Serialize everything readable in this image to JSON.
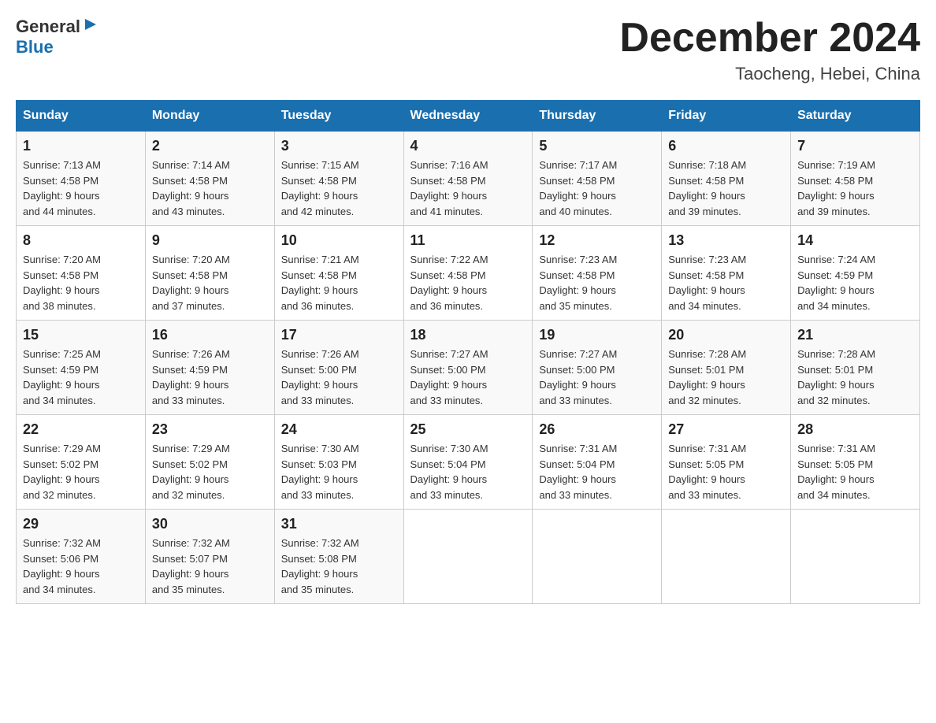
{
  "header": {
    "logo_general": "General",
    "logo_blue": "Blue",
    "month_title": "December 2024",
    "location": "Taocheng, Hebei, China"
  },
  "calendar": {
    "days_of_week": [
      "Sunday",
      "Monday",
      "Tuesday",
      "Wednesday",
      "Thursday",
      "Friday",
      "Saturday"
    ],
    "weeks": [
      [
        {
          "day": "1",
          "sunrise": "7:13 AM",
          "sunset": "4:58 PM",
          "daylight": "9 hours and 44 minutes."
        },
        {
          "day": "2",
          "sunrise": "7:14 AM",
          "sunset": "4:58 PM",
          "daylight": "9 hours and 43 minutes."
        },
        {
          "day": "3",
          "sunrise": "7:15 AM",
          "sunset": "4:58 PM",
          "daylight": "9 hours and 42 minutes."
        },
        {
          "day": "4",
          "sunrise": "7:16 AM",
          "sunset": "4:58 PM",
          "daylight": "9 hours and 41 minutes."
        },
        {
          "day": "5",
          "sunrise": "7:17 AM",
          "sunset": "4:58 PM",
          "daylight": "9 hours and 40 minutes."
        },
        {
          "day": "6",
          "sunrise": "7:18 AM",
          "sunset": "4:58 PM",
          "daylight": "9 hours and 39 minutes."
        },
        {
          "day": "7",
          "sunrise": "7:19 AM",
          "sunset": "4:58 PM",
          "daylight": "9 hours and 39 minutes."
        }
      ],
      [
        {
          "day": "8",
          "sunrise": "7:20 AM",
          "sunset": "4:58 PM",
          "daylight": "9 hours and 38 minutes."
        },
        {
          "day": "9",
          "sunrise": "7:20 AM",
          "sunset": "4:58 PM",
          "daylight": "9 hours and 37 minutes."
        },
        {
          "day": "10",
          "sunrise": "7:21 AM",
          "sunset": "4:58 PM",
          "daylight": "9 hours and 36 minutes."
        },
        {
          "day": "11",
          "sunrise": "7:22 AM",
          "sunset": "4:58 PM",
          "daylight": "9 hours and 36 minutes."
        },
        {
          "day": "12",
          "sunrise": "7:23 AM",
          "sunset": "4:58 PM",
          "daylight": "9 hours and 35 minutes."
        },
        {
          "day": "13",
          "sunrise": "7:23 AM",
          "sunset": "4:58 PM",
          "daylight": "9 hours and 34 minutes."
        },
        {
          "day": "14",
          "sunrise": "7:24 AM",
          "sunset": "4:59 PM",
          "daylight": "9 hours and 34 minutes."
        }
      ],
      [
        {
          "day": "15",
          "sunrise": "7:25 AM",
          "sunset": "4:59 PM",
          "daylight": "9 hours and 34 minutes."
        },
        {
          "day": "16",
          "sunrise": "7:26 AM",
          "sunset": "4:59 PM",
          "daylight": "9 hours and 33 minutes."
        },
        {
          "day": "17",
          "sunrise": "7:26 AM",
          "sunset": "5:00 PM",
          "daylight": "9 hours and 33 minutes."
        },
        {
          "day": "18",
          "sunrise": "7:27 AM",
          "sunset": "5:00 PM",
          "daylight": "9 hours and 33 minutes."
        },
        {
          "day": "19",
          "sunrise": "7:27 AM",
          "sunset": "5:00 PM",
          "daylight": "9 hours and 33 minutes."
        },
        {
          "day": "20",
          "sunrise": "7:28 AM",
          "sunset": "5:01 PM",
          "daylight": "9 hours and 32 minutes."
        },
        {
          "day": "21",
          "sunrise": "7:28 AM",
          "sunset": "5:01 PM",
          "daylight": "9 hours and 32 minutes."
        }
      ],
      [
        {
          "day": "22",
          "sunrise": "7:29 AM",
          "sunset": "5:02 PM",
          "daylight": "9 hours and 32 minutes."
        },
        {
          "day": "23",
          "sunrise": "7:29 AM",
          "sunset": "5:02 PM",
          "daylight": "9 hours and 32 minutes."
        },
        {
          "day": "24",
          "sunrise": "7:30 AM",
          "sunset": "5:03 PM",
          "daylight": "9 hours and 33 minutes."
        },
        {
          "day": "25",
          "sunrise": "7:30 AM",
          "sunset": "5:04 PM",
          "daylight": "9 hours and 33 minutes."
        },
        {
          "day": "26",
          "sunrise": "7:31 AM",
          "sunset": "5:04 PM",
          "daylight": "9 hours and 33 minutes."
        },
        {
          "day": "27",
          "sunrise": "7:31 AM",
          "sunset": "5:05 PM",
          "daylight": "9 hours and 33 minutes."
        },
        {
          "day": "28",
          "sunrise": "7:31 AM",
          "sunset": "5:05 PM",
          "daylight": "9 hours and 34 minutes."
        }
      ],
      [
        {
          "day": "29",
          "sunrise": "7:32 AM",
          "sunset": "5:06 PM",
          "daylight": "9 hours and 34 minutes."
        },
        {
          "day": "30",
          "sunrise": "7:32 AM",
          "sunset": "5:07 PM",
          "daylight": "9 hours and 35 minutes."
        },
        {
          "day": "31",
          "sunrise": "7:32 AM",
          "sunset": "5:08 PM",
          "daylight": "9 hours and 35 minutes."
        },
        null,
        null,
        null,
        null
      ]
    ],
    "labels": {
      "sunrise": "Sunrise:",
      "sunset": "Sunset:",
      "daylight": "Daylight:"
    }
  }
}
